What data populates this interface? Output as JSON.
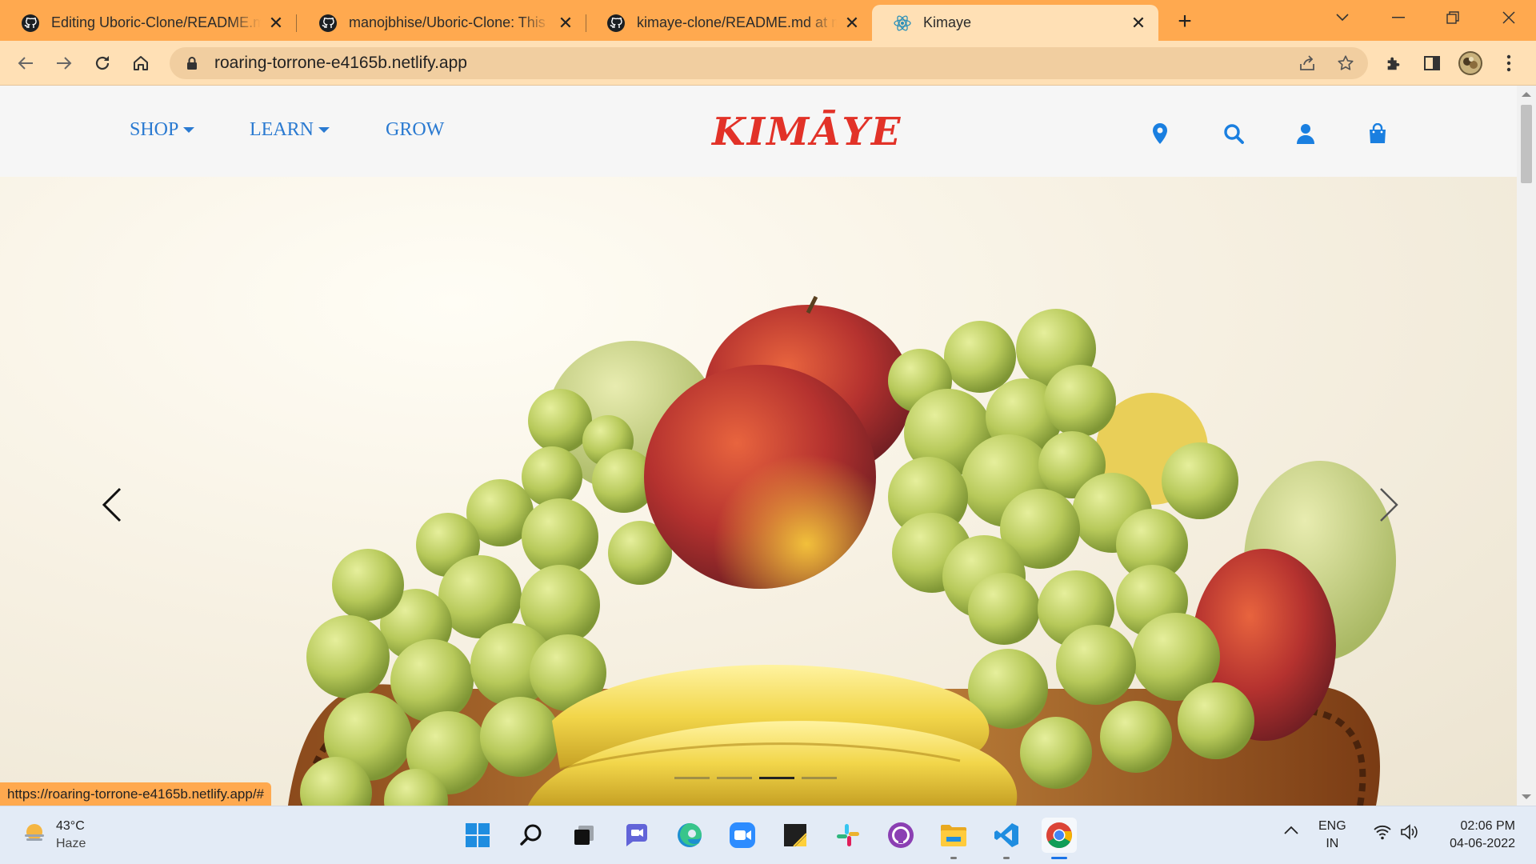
{
  "browser": {
    "tabs": [
      {
        "title": "Editing Uboric-Clone/README.md at main · manojbhise/Uboric-Clone",
        "favicon": "github-icon",
        "active": false
      },
      {
        "title": "manojbhise/Uboric-Clone: This is a clone",
        "favicon": "github-icon",
        "active": false
      },
      {
        "title": "kimaye-clone/README.md at main",
        "favicon": "github-icon",
        "active": false
      },
      {
        "title": "Kimaye",
        "favicon": "react-icon",
        "active": true
      }
    ],
    "url": "roaring-torrone-e4165b.netlify.app",
    "status_url": "https://roaring-torrone-e4165b.netlify.app/#"
  },
  "site": {
    "nav": {
      "shop": "SHOP",
      "learn": "LEARN",
      "grow": "GROW"
    },
    "logo": "KIMĀYE",
    "icons": [
      "location-icon",
      "search-icon",
      "user-icon",
      "shopping-bag-icon"
    ],
    "carousel": {
      "slide_count": 4,
      "active_index": 2,
      "image": "fruit-basket-photo"
    },
    "colors": {
      "nav_link": "#2a7ad1",
      "logo": "#e23228",
      "accent_icons": "#1a7fe0"
    }
  },
  "taskbar": {
    "weather": {
      "temp": "43°C",
      "condition": "Haze"
    },
    "apps": [
      "start-icon",
      "search-icon",
      "task-view-icon",
      "chat-icon",
      "edge-icon",
      "zoom-icon",
      "sticky-notes-icon",
      "slack-icon",
      "github-desktop-icon",
      "file-explorer-icon",
      "vscode-icon",
      "chrome-icon"
    ],
    "language": {
      "line1": "ENG",
      "line2": "IN"
    },
    "clock": {
      "time": "02:06 PM",
      "date": "04-06-2022"
    }
  }
}
